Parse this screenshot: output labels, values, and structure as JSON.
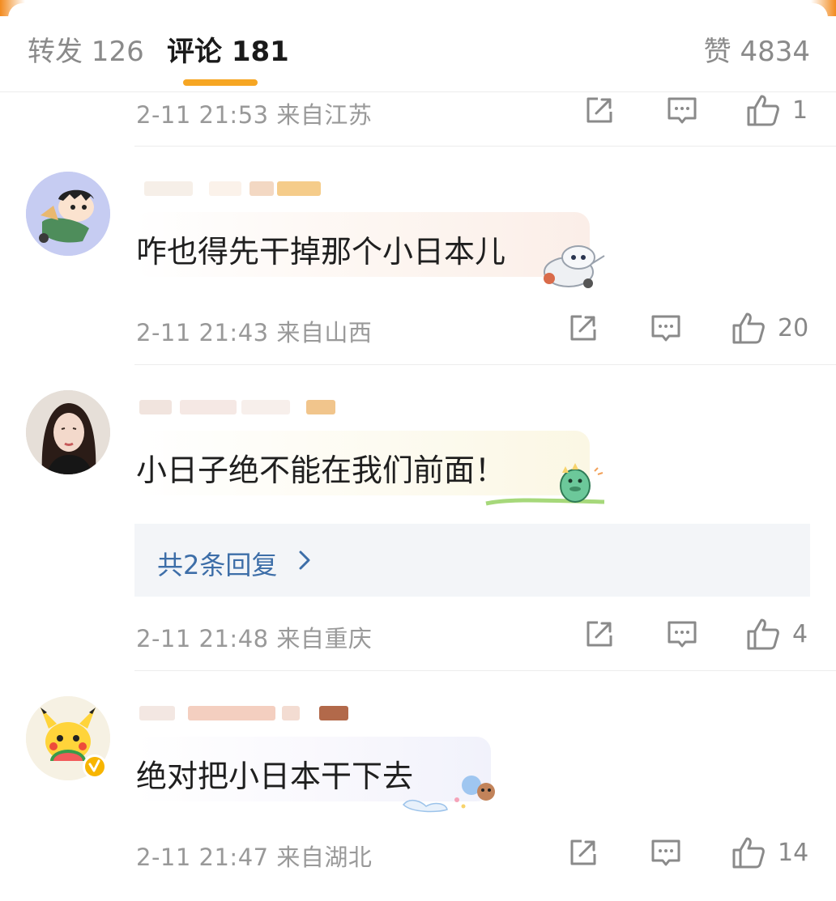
{
  "tabs": {
    "reposts_label": "转发 126",
    "comments_label": "评论 181",
    "likes_label": "赞 4834"
  },
  "colors": {
    "accent": "#f6a623",
    "meta_text": "#999999",
    "reply_link": "#3d6ea8",
    "reply_bg": "#f3f5f8"
  },
  "icons": [
    "share-icon",
    "reply-icon",
    "thumbs-up-icon",
    "chevron-right-icon",
    "verified-badge-icon"
  ],
  "comments": [
    {
      "meta": "2-11 21:53 来自江苏",
      "likes": "1"
    },
    {
      "text": "咋也得先干掉那个小日本儿",
      "meta": "2-11 21:43 来自山西",
      "likes": "20"
    },
    {
      "text": "小日子绝不能在我们前面！",
      "reply_link": "共2条回复",
      "meta": "2-11 21:48 来自重庆",
      "likes": "4"
    },
    {
      "text": "绝对把小日本干下去",
      "meta": "2-11 21:47 来自湖北",
      "likes": "14"
    }
  ]
}
